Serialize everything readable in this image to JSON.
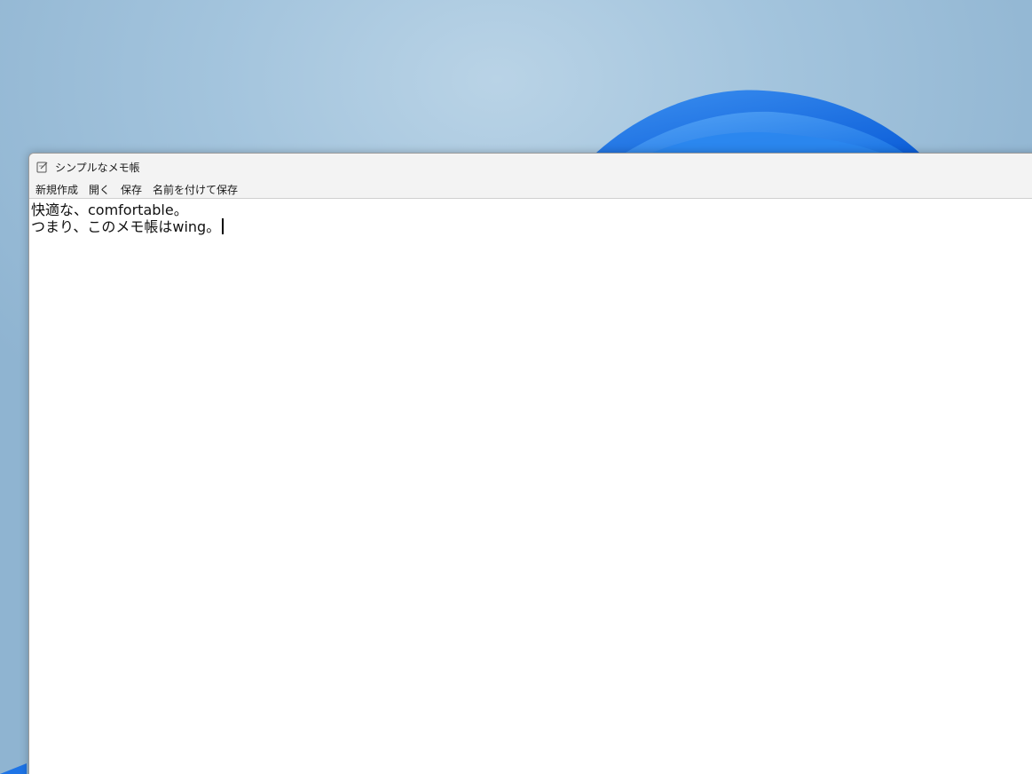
{
  "window": {
    "title": "シンプルなメモ帳",
    "app_icon": "notepad-icon"
  },
  "menu": {
    "items": [
      {
        "label": "新規作成"
      },
      {
        "label": "開く"
      },
      {
        "label": "保存"
      },
      {
        "label": "名前を付けて保存"
      }
    ]
  },
  "editor": {
    "lines": [
      "快適な、comfortable。",
      "つまり、このメモ帳はwing。"
    ]
  },
  "colors": {
    "accent_blue": "#1e74e6",
    "titlebar_bg": "#f3f3f3"
  }
}
